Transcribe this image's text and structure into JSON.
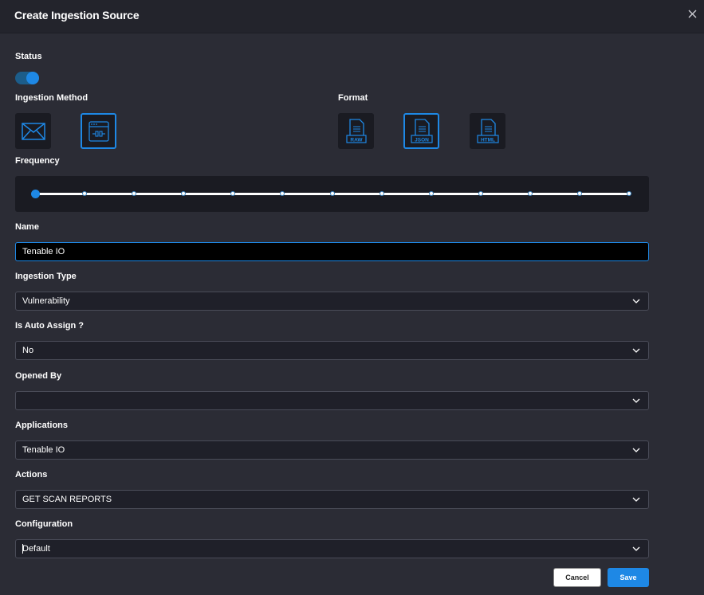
{
  "header": {
    "title": "Create Ingestion Source",
    "close_icon": "close-icon"
  },
  "status": {
    "label": "Status",
    "enabled": true
  },
  "ingestion_method": {
    "label": "Ingestion Method",
    "options": [
      {
        "icon": "email-icon",
        "selected": false
      },
      {
        "icon": "api-icon",
        "selected": true
      }
    ]
  },
  "format": {
    "label": "Format",
    "options": [
      {
        "icon": "raw-file-icon",
        "badge": "RAW",
        "selected": false
      },
      {
        "icon": "json-file-icon",
        "badge": "JSON",
        "selected": true
      },
      {
        "icon": "html-file-icon",
        "badge": "HTML",
        "selected": false
      }
    ]
  },
  "frequency": {
    "label": "Frequency",
    "steps": 13,
    "selected_index": 0
  },
  "name": {
    "label": "Name",
    "value": "Tenable IO"
  },
  "ingestion_type": {
    "label": "Ingestion Type",
    "value": "Vulnerability"
  },
  "auto_assign": {
    "label": "Is Auto Assign ?",
    "value": "No"
  },
  "opened_by": {
    "label": "Opened By",
    "value": ""
  },
  "applications": {
    "label": "Applications",
    "value": "Tenable IO"
  },
  "actions": {
    "label": "Actions",
    "value": "GET SCAN REPORTS"
  },
  "configuration": {
    "label": "Configuration",
    "value": "Default"
  },
  "buttons": {
    "cancel": "Cancel",
    "save": "Save"
  },
  "colors": {
    "accent": "#1e88e5",
    "background": "#2b2c35",
    "header": "#23242c"
  }
}
